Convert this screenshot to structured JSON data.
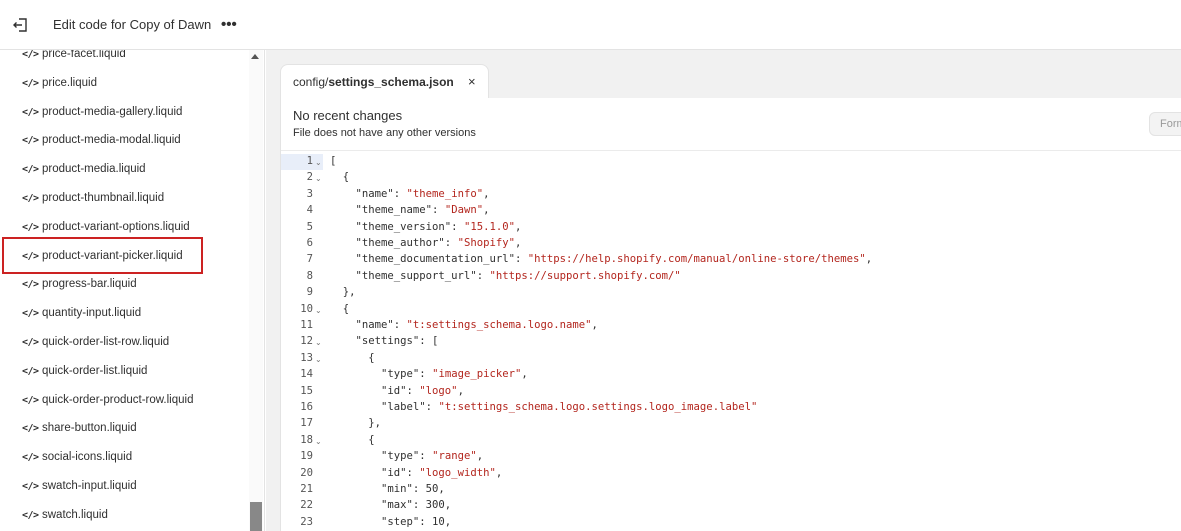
{
  "topbar": {
    "title": "Edit code for Copy of Dawn",
    "more_label": "•••"
  },
  "sidebar": {
    "icon_glyph": "</>",
    "items": [
      "price-facet.liquid",
      "price.liquid",
      "product-media-gallery.liquid",
      "product-media-modal.liquid",
      "product-media.liquid",
      "product-thumbnail.liquid",
      "product-variant-options.liquid",
      "product-variant-picker.liquid",
      "progress-bar.liquid",
      "quantity-input.liquid",
      "quick-order-list-row.liquid",
      "quick-order-list.liquid",
      "quick-order-product-row.liquid",
      "share-button.liquid",
      "social-icons.liquid",
      "swatch-input.liquid",
      "swatch.liquid"
    ],
    "highlighted_item": "product-variant-picker.liquid",
    "highlight_color": "#cc2222"
  },
  "tab": {
    "folder": "config/",
    "filename": "settings_schema.json",
    "close_label": "×"
  },
  "panel": {
    "title": "No recent changes",
    "subtitle": "File does not have any other versions",
    "format_label": "Format"
  },
  "code": {
    "string_color": "#b3261e",
    "lines": [
      {
        "n": "1",
        "fold": true,
        "parts": [
          [
            "p",
            "["
          ]
        ]
      },
      {
        "n": "2",
        "fold": true,
        "parts": [
          [
            "p",
            "  {"
          ]
        ]
      },
      {
        "n": "3",
        "fold": false,
        "parts": [
          [
            "p",
            "    \"name\": "
          ],
          [
            "s",
            "\"theme_info\""
          ],
          [
            "p",
            ","
          ]
        ]
      },
      {
        "n": "4",
        "fold": false,
        "parts": [
          [
            "p",
            "    \"theme_name\": "
          ],
          [
            "s",
            "\"Dawn\""
          ],
          [
            "p",
            ","
          ]
        ]
      },
      {
        "n": "5",
        "fold": false,
        "parts": [
          [
            "p",
            "    \"theme_version\": "
          ],
          [
            "s",
            "\"15.1.0\""
          ],
          [
            "p",
            ","
          ]
        ]
      },
      {
        "n": "6",
        "fold": false,
        "parts": [
          [
            "p",
            "    \"theme_author\": "
          ],
          [
            "s",
            "\"Shopify\""
          ],
          [
            "p",
            ","
          ]
        ]
      },
      {
        "n": "7",
        "fold": false,
        "parts": [
          [
            "p",
            "    \"theme_documentation_url\": "
          ],
          [
            "s",
            "\"https://help.shopify.com/manual/online-store/themes\""
          ],
          [
            "p",
            ","
          ]
        ]
      },
      {
        "n": "8",
        "fold": false,
        "parts": [
          [
            "p",
            "    \"theme_support_url\": "
          ],
          [
            "s",
            "\"https://support.shopify.com/\""
          ]
        ]
      },
      {
        "n": "9",
        "fold": false,
        "parts": [
          [
            "p",
            "  },"
          ]
        ]
      },
      {
        "n": "10",
        "fold": true,
        "parts": [
          [
            "p",
            "  {"
          ]
        ]
      },
      {
        "n": "11",
        "fold": false,
        "parts": [
          [
            "p",
            "    \"name\": "
          ],
          [
            "s",
            "\"t:settings_schema.logo.name\""
          ],
          [
            "p",
            ","
          ]
        ]
      },
      {
        "n": "12",
        "fold": true,
        "parts": [
          [
            "p",
            "    \"settings\": ["
          ]
        ]
      },
      {
        "n": "13",
        "fold": true,
        "parts": [
          [
            "p",
            "      {"
          ]
        ]
      },
      {
        "n": "14",
        "fold": false,
        "parts": [
          [
            "p",
            "        \"type\": "
          ],
          [
            "s",
            "\"image_picker\""
          ],
          [
            "p",
            ","
          ]
        ]
      },
      {
        "n": "15",
        "fold": false,
        "parts": [
          [
            "p",
            "        \"id\": "
          ],
          [
            "s",
            "\"logo\""
          ],
          [
            "p",
            ","
          ]
        ]
      },
      {
        "n": "16",
        "fold": false,
        "parts": [
          [
            "p",
            "        \"label\": "
          ],
          [
            "s",
            "\"t:settings_schema.logo.settings.logo_image.label\""
          ]
        ]
      },
      {
        "n": "17",
        "fold": false,
        "parts": [
          [
            "p",
            "      },"
          ]
        ]
      },
      {
        "n": "18",
        "fold": true,
        "parts": [
          [
            "p",
            "      {"
          ]
        ]
      },
      {
        "n": "19",
        "fold": false,
        "parts": [
          [
            "p",
            "        \"type\": "
          ],
          [
            "s",
            "\"range\""
          ],
          [
            "p",
            ","
          ]
        ]
      },
      {
        "n": "20",
        "fold": false,
        "parts": [
          [
            "p",
            "        \"id\": "
          ],
          [
            "s",
            "\"logo_width\""
          ],
          [
            "p",
            ","
          ]
        ]
      },
      {
        "n": "21",
        "fold": false,
        "parts": [
          [
            "p",
            "        \"min\": 50,"
          ]
        ]
      },
      {
        "n": "22",
        "fold": false,
        "parts": [
          [
            "p",
            "        \"max\": 300,"
          ]
        ]
      },
      {
        "n": "23",
        "fold": false,
        "parts": [
          [
            "p",
            "        \"step\": 10,"
          ]
        ]
      }
    ]
  }
}
